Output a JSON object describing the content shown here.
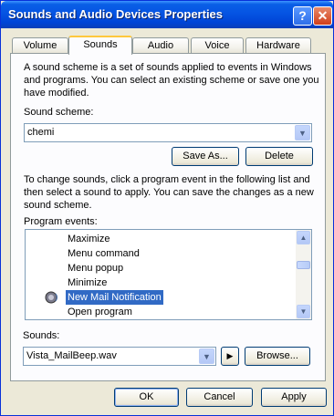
{
  "window": {
    "title": "Sounds and Audio Devices Properties",
    "help_label": "?",
    "close_label": "✕"
  },
  "tabs": [
    {
      "label": "Volume"
    },
    {
      "label": "Sounds"
    },
    {
      "label": "Audio"
    },
    {
      "label": "Voice"
    },
    {
      "label": "Hardware"
    }
  ],
  "sounds_tab": {
    "intro_line1": "A sound scheme is a set of sounds applied to events in Windows",
    "intro_line2": "and programs. You can select an existing scheme or save one you",
    "intro_line3": "have modified.",
    "scheme_label": "Sound scheme:",
    "scheme_value": "chemi",
    "save_as_label": "Save As...",
    "delete_label": "Delete",
    "change_line1": "To change sounds, click a program event in the following list and",
    "change_line2": "then select a sound to apply. You can save the changes as a new",
    "change_line3": "sound scheme.",
    "events_label": "Program events:",
    "events": [
      {
        "label": "Maximize"
      },
      {
        "label": "Menu command"
      },
      {
        "label": "Menu popup"
      },
      {
        "label": "Minimize"
      },
      {
        "label": "New Mail Notification"
      },
      {
        "label": "Open program"
      }
    ],
    "sounds_label": "Sounds:",
    "sound_value": "Vista_MailBeep.wav",
    "browse_label": "Browse..."
  },
  "footer": {
    "ok_label": "OK",
    "cancel_label": "Cancel",
    "apply_label": "Apply"
  },
  "icons": {
    "speaker": "speaker-icon",
    "dropdown": "chevron-down-icon",
    "play": "play-icon"
  }
}
